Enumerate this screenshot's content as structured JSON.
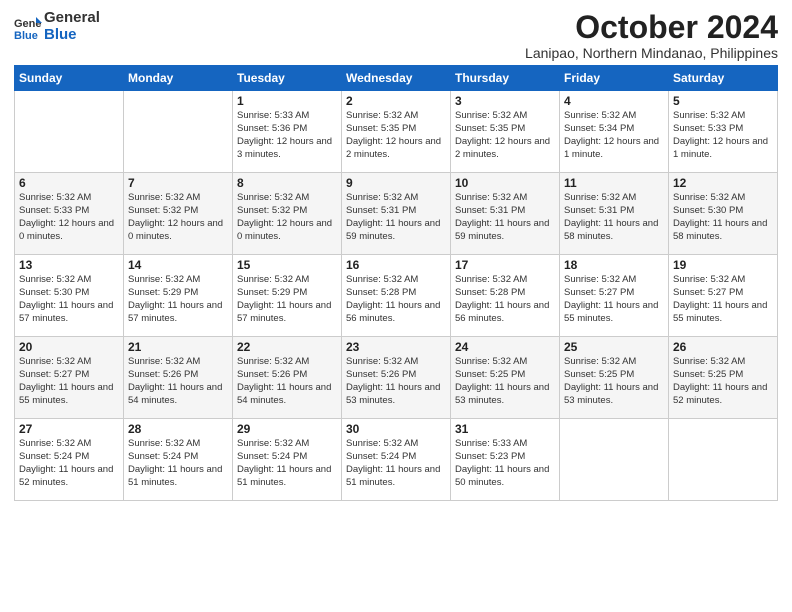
{
  "header": {
    "logo_general": "General",
    "logo_blue": "Blue",
    "month": "October 2024",
    "location": "Lanipao, Northern Mindanao, Philippines"
  },
  "days_of_week": [
    "Sunday",
    "Monday",
    "Tuesday",
    "Wednesday",
    "Thursday",
    "Friday",
    "Saturday"
  ],
  "weeks": [
    [
      {
        "day": "",
        "info": ""
      },
      {
        "day": "",
        "info": ""
      },
      {
        "day": "1",
        "info": "Sunrise: 5:33 AM\nSunset: 5:36 PM\nDaylight: 12 hours\nand 3 minutes."
      },
      {
        "day": "2",
        "info": "Sunrise: 5:32 AM\nSunset: 5:35 PM\nDaylight: 12 hours\nand 2 minutes."
      },
      {
        "day": "3",
        "info": "Sunrise: 5:32 AM\nSunset: 5:35 PM\nDaylight: 12 hours\nand 2 minutes."
      },
      {
        "day": "4",
        "info": "Sunrise: 5:32 AM\nSunset: 5:34 PM\nDaylight: 12 hours\nand 1 minute."
      },
      {
        "day": "5",
        "info": "Sunrise: 5:32 AM\nSunset: 5:33 PM\nDaylight: 12 hours\nand 1 minute."
      }
    ],
    [
      {
        "day": "6",
        "info": "Sunrise: 5:32 AM\nSunset: 5:33 PM\nDaylight: 12 hours\nand 0 minutes."
      },
      {
        "day": "7",
        "info": "Sunrise: 5:32 AM\nSunset: 5:32 PM\nDaylight: 12 hours\nand 0 minutes."
      },
      {
        "day": "8",
        "info": "Sunrise: 5:32 AM\nSunset: 5:32 PM\nDaylight: 12 hours\nand 0 minutes."
      },
      {
        "day": "9",
        "info": "Sunrise: 5:32 AM\nSunset: 5:31 PM\nDaylight: 11 hours\nand 59 minutes."
      },
      {
        "day": "10",
        "info": "Sunrise: 5:32 AM\nSunset: 5:31 PM\nDaylight: 11 hours\nand 59 minutes."
      },
      {
        "day": "11",
        "info": "Sunrise: 5:32 AM\nSunset: 5:31 PM\nDaylight: 11 hours\nand 58 minutes."
      },
      {
        "day": "12",
        "info": "Sunrise: 5:32 AM\nSunset: 5:30 PM\nDaylight: 11 hours\nand 58 minutes."
      }
    ],
    [
      {
        "day": "13",
        "info": "Sunrise: 5:32 AM\nSunset: 5:30 PM\nDaylight: 11 hours\nand 57 minutes."
      },
      {
        "day": "14",
        "info": "Sunrise: 5:32 AM\nSunset: 5:29 PM\nDaylight: 11 hours\nand 57 minutes."
      },
      {
        "day": "15",
        "info": "Sunrise: 5:32 AM\nSunset: 5:29 PM\nDaylight: 11 hours\nand 57 minutes."
      },
      {
        "day": "16",
        "info": "Sunrise: 5:32 AM\nSunset: 5:28 PM\nDaylight: 11 hours\nand 56 minutes."
      },
      {
        "day": "17",
        "info": "Sunrise: 5:32 AM\nSunset: 5:28 PM\nDaylight: 11 hours\nand 56 minutes."
      },
      {
        "day": "18",
        "info": "Sunrise: 5:32 AM\nSunset: 5:27 PM\nDaylight: 11 hours\nand 55 minutes."
      },
      {
        "day": "19",
        "info": "Sunrise: 5:32 AM\nSunset: 5:27 PM\nDaylight: 11 hours\nand 55 minutes."
      }
    ],
    [
      {
        "day": "20",
        "info": "Sunrise: 5:32 AM\nSunset: 5:27 PM\nDaylight: 11 hours\nand 55 minutes."
      },
      {
        "day": "21",
        "info": "Sunrise: 5:32 AM\nSunset: 5:26 PM\nDaylight: 11 hours\nand 54 minutes."
      },
      {
        "day": "22",
        "info": "Sunrise: 5:32 AM\nSunset: 5:26 PM\nDaylight: 11 hours\nand 54 minutes."
      },
      {
        "day": "23",
        "info": "Sunrise: 5:32 AM\nSunset: 5:26 PM\nDaylight: 11 hours\nand 53 minutes."
      },
      {
        "day": "24",
        "info": "Sunrise: 5:32 AM\nSunset: 5:25 PM\nDaylight: 11 hours\nand 53 minutes."
      },
      {
        "day": "25",
        "info": "Sunrise: 5:32 AM\nSunset: 5:25 PM\nDaylight: 11 hours\nand 53 minutes."
      },
      {
        "day": "26",
        "info": "Sunrise: 5:32 AM\nSunset: 5:25 PM\nDaylight: 11 hours\nand 52 minutes."
      }
    ],
    [
      {
        "day": "27",
        "info": "Sunrise: 5:32 AM\nSunset: 5:24 PM\nDaylight: 11 hours\nand 52 minutes."
      },
      {
        "day": "28",
        "info": "Sunrise: 5:32 AM\nSunset: 5:24 PM\nDaylight: 11 hours\nand 51 minutes."
      },
      {
        "day": "29",
        "info": "Sunrise: 5:32 AM\nSunset: 5:24 PM\nDaylight: 11 hours\nand 51 minutes."
      },
      {
        "day": "30",
        "info": "Sunrise: 5:32 AM\nSunset: 5:24 PM\nDaylight: 11 hours\nand 51 minutes."
      },
      {
        "day": "31",
        "info": "Sunrise: 5:33 AM\nSunset: 5:23 PM\nDaylight: 11 hours\nand 50 minutes."
      },
      {
        "day": "",
        "info": ""
      },
      {
        "day": "",
        "info": ""
      }
    ]
  ]
}
